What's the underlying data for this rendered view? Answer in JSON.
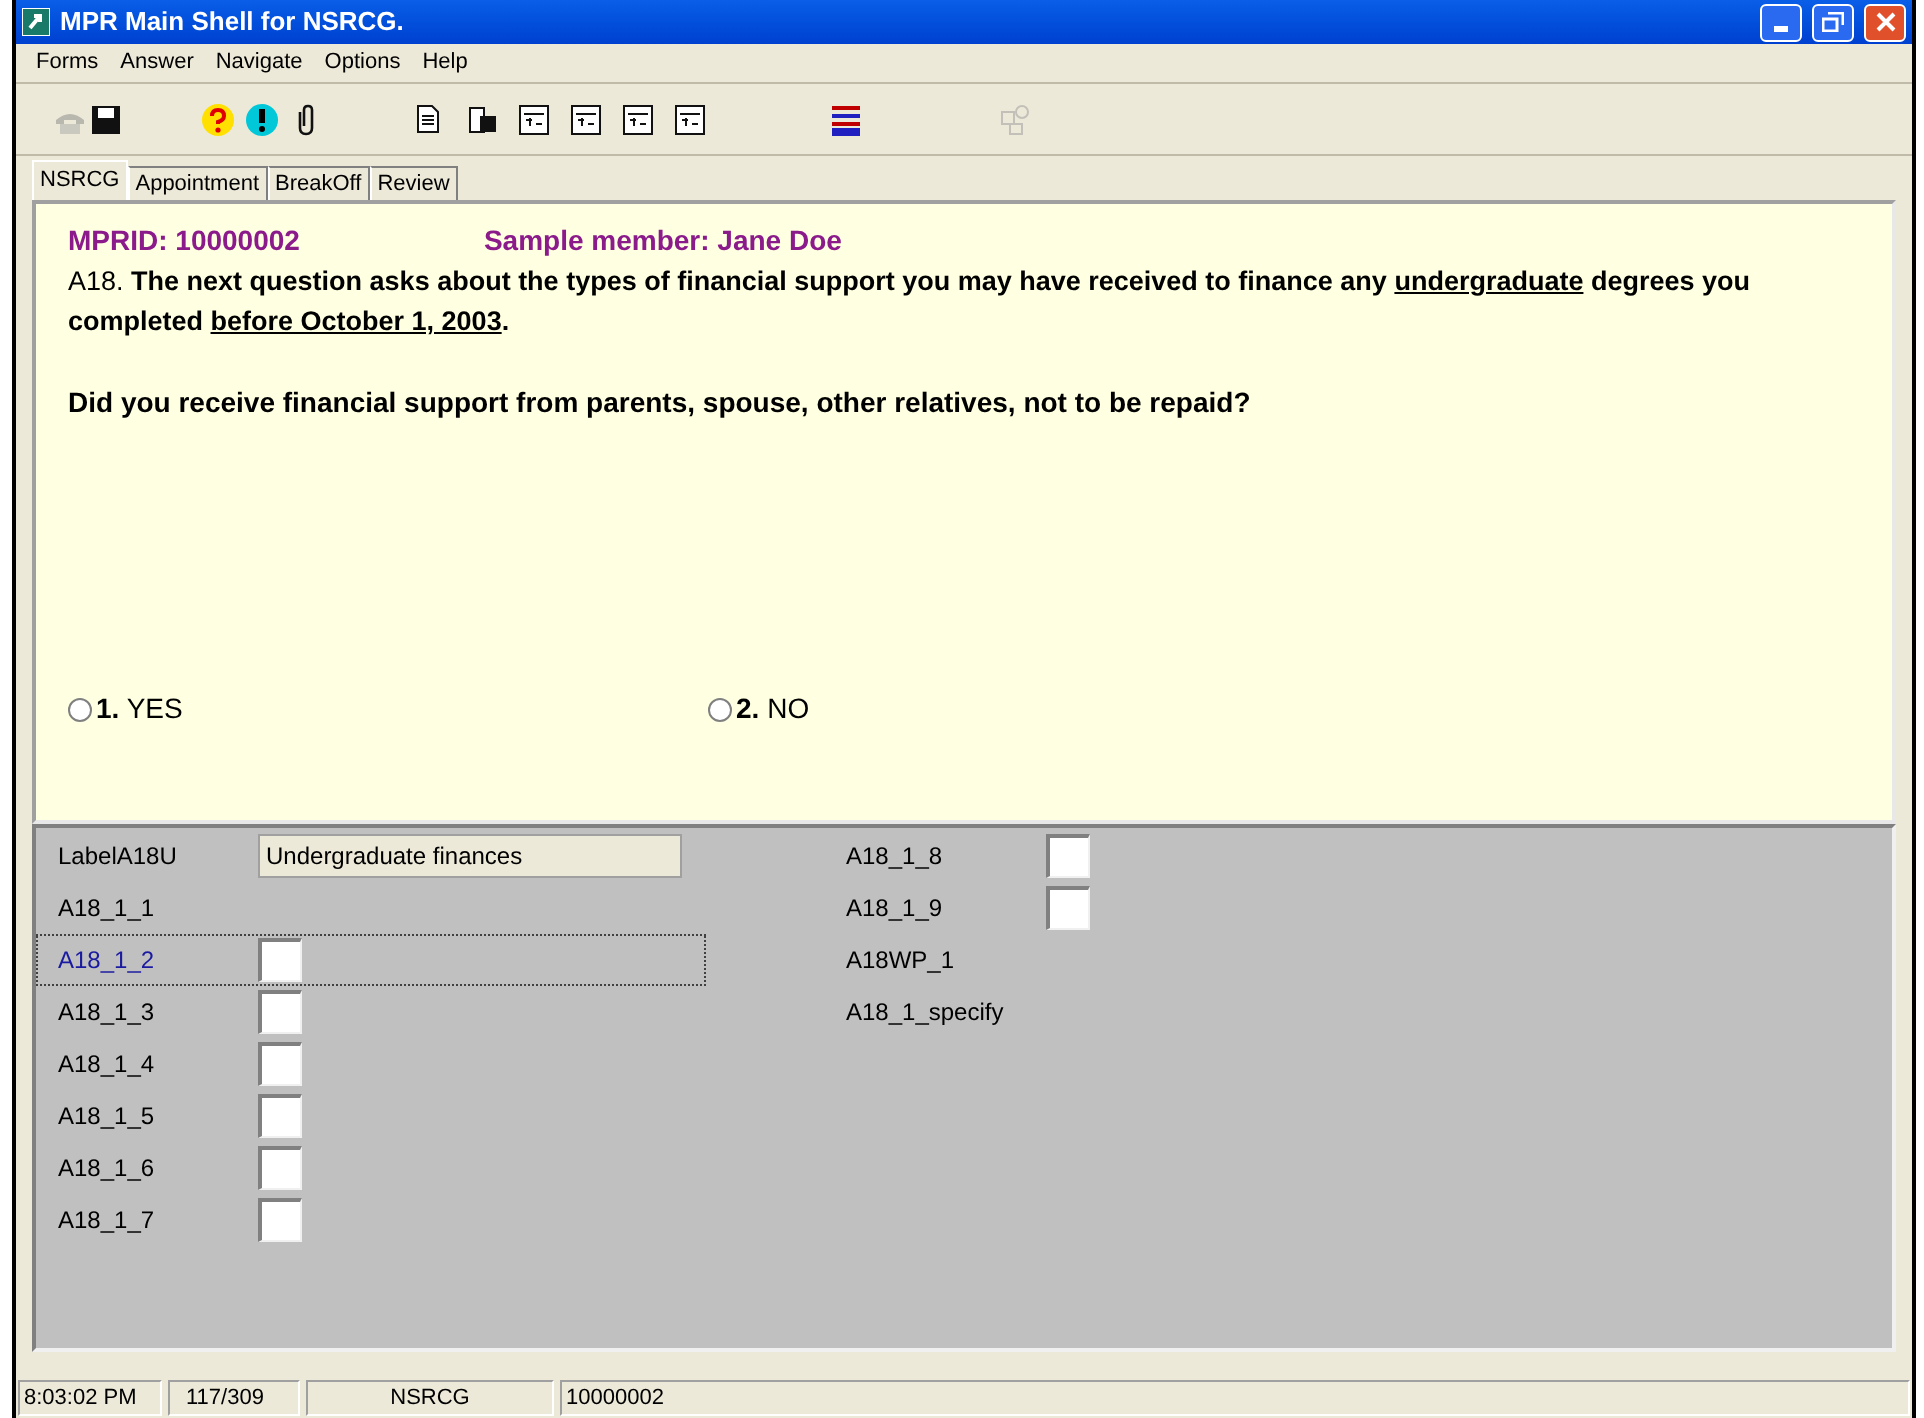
{
  "window": {
    "title": "MPR Main Shell for NSRCG."
  },
  "menu": [
    "Forms",
    "Answer",
    "Navigate",
    "Options",
    "Help"
  ],
  "tabs": [
    {
      "label": "NSRCG",
      "selected": true
    },
    {
      "label": "Appointment",
      "selected": false
    },
    {
      "label": "BreakOff",
      "selected": false
    },
    {
      "label": "Review",
      "selected": false
    }
  ],
  "question": {
    "mprid": "MPRID: 10000002",
    "sample_member": "Sample member: Jane Doe",
    "number": "A18.",
    "parts": [
      {
        "text": "The next question asks about the types of financial support you may have received to finance any ",
        "underlined": false
      },
      {
        "text": "undergraduate",
        "underlined": true
      },
      {
        "text": " degrees you completed ",
        "underlined": false
      },
      {
        "text": "before October 1, 2003",
        "underlined": true
      },
      {
        "text": ".",
        "underlined": false
      }
    ],
    "prompt": "Did you receive financial support from parents, spouse, other relatives, not to be repaid?",
    "options": [
      {
        "number": "1.",
        "label": "YES",
        "selected": false
      },
      {
        "number": "2.",
        "label": "NO",
        "selected": false
      }
    ]
  },
  "fields": {
    "left": [
      {
        "name": "LabelA18U",
        "kind": "text",
        "value": "Undergraduate finances",
        "focused": false
      },
      {
        "name": "A18_1_1",
        "kind": "none",
        "focused": false
      },
      {
        "name": "A18_1_2",
        "kind": "box",
        "focused": true
      },
      {
        "name": "A18_1_3",
        "kind": "box",
        "focused": false
      },
      {
        "name": "A18_1_4",
        "kind": "box",
        "focused": false
      },
      {
        "name": "A18_1_5",
        "kind": "box",
        "focused": false
      },
      {
        "name": "A18_1_6",
        "kind": "box",
        "focused": false
      },
      {
        "name": "A18_1_7",
        "kind": "box",
        "focused": false
      }
    ],
    "right": [
      {
        "name": "A18_1_8",
        "kind": "box",
        "focused": false
      },
      {
        "name": "A18_1_9",
        "kind": "box",
        "focused": false
      },
      {
        "name": "A18WP_1",
        "kind": "none",
        "focused": false
      },
      {
        "name": "A18_1_specify",
        "kind": "none",
        "focused": false
      }
    ]
  },
  "status_bar": [
    "8:03:02 PM",
    "117/309",
    "NSRCG",
    "10000002"
  ]
}
